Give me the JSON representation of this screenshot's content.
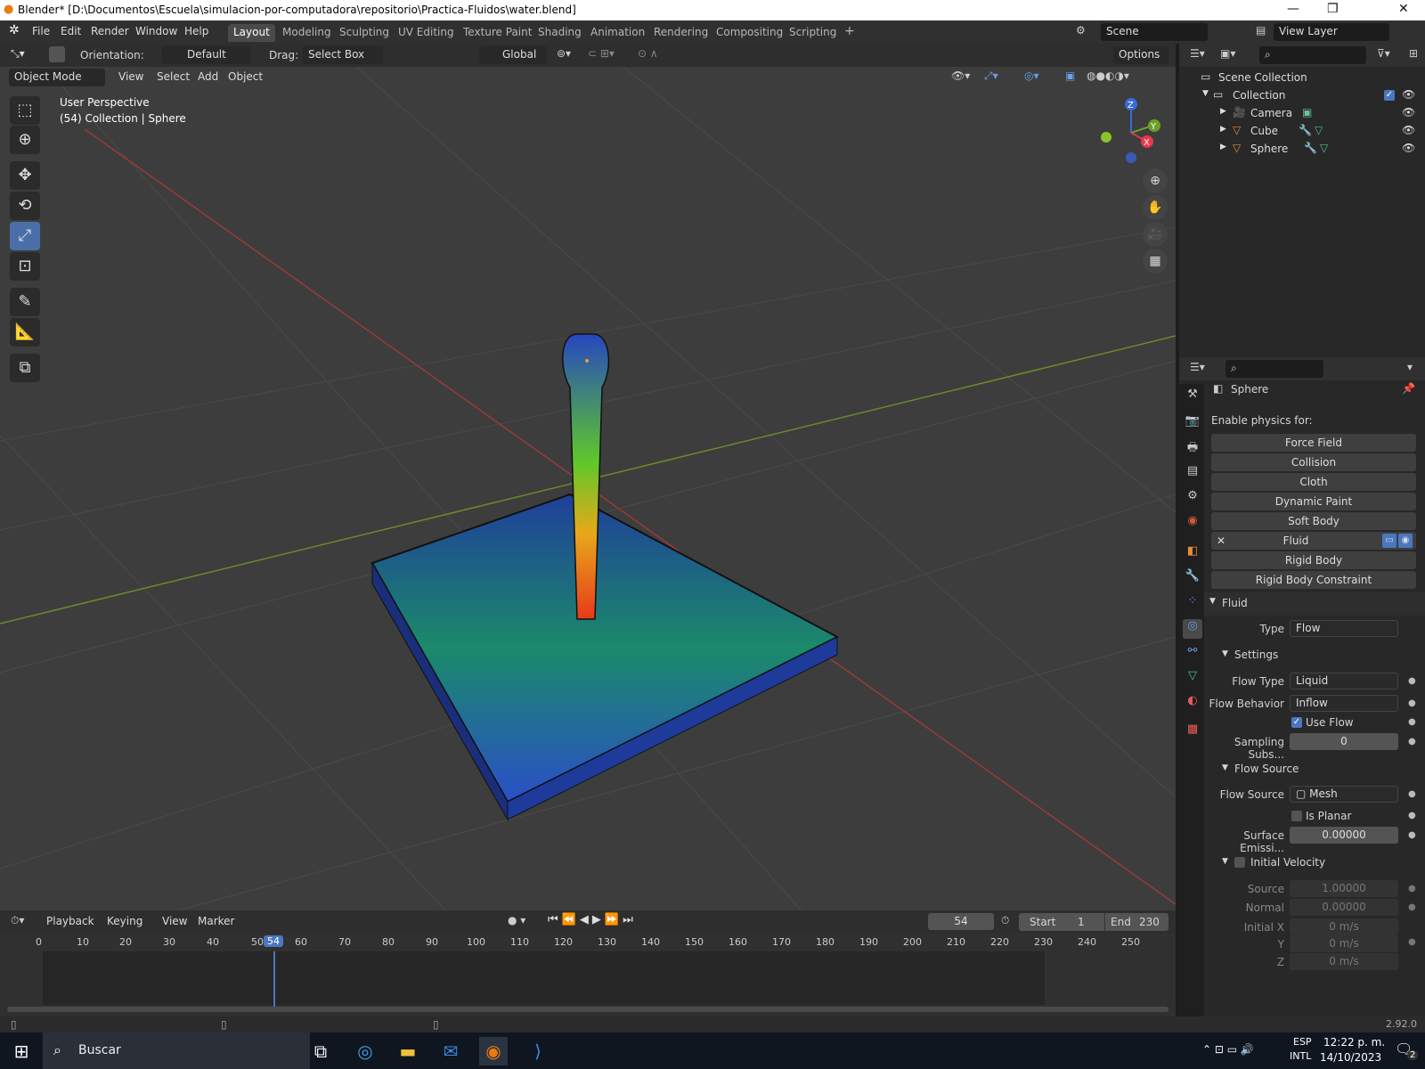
{
  "window": {
    "title": "Blender* [D:\\Documentos\\Escuela\\simulacion-por-computadora\\repositorio\\Practica-Fluidos\\water.blend]",
    "minimize": "—",
    "maximize": "❐",
    "close": "✕"
  },
  "menubar": {
    "items": [
      "File",
      "Edit",
      "Render",
      "Window",
      "Help"
    ],
    "workspaces": [
      "Layout",
      "Modeling",
      "Sculpting",
      "UV Editing",
      "Texture Paint",
      "Shading",
      "Animation",
      "Rendering",
      "Compositing",
      "Scripting"
    ],
    "add_tab": "+",
    "scene": "Scene",
    "view_layer": "View Layer"
  },
  "tool_header": {
    "orientation_label": "Orientation:",
    "orientation_value": "Default",
    "drag_label": "Drag:",
    "drag_value": "Select Box",
    "transform_orientation": "Global",
    "options": "Options"
  },
  "viewport_header": {
    "mode": "Object Mode",
    "menus": [
      "View",
      "Select",
      "Add",
      "Object"
    ]
  },
  "viewport": {
    "perspective": "User Perspective",
    "info": "(54) Collection | Sphere",
    "gizmo": {
      "z": "Z",
      "y": "Y",
      "x": "X"
    }
  },
  "outliner": {
    "scene_collection": "Scene Collection",
    "collection": "Collection",
    "objects": [
      "Camera",
      "Cube",
      "Sphere"
    ]
  },
  "properties": {
    "object_name": "Sphere",
    "enable_physics_label": "Enable physics for:",
    "physics_buttons": [
      "Force Field",
      "Collision",
      "Cloth",
      "Dynamic Paint",
      "Soft Body",
      "Fluid",
      "Rigid Body",
      "Rigid Body Constraint"
    ],
    "fluid_panel": "Fluid",
    "type_label": "Type",
    "type_value": "Flow",
    "settings_label": "Settings",
    "flow_type_label": "Flow Type",
    "flow_type_value": "Liquid",
    "flow_behavior_label": "Flow Behavior",
    "flow_behavior_value": "Inflow",
    "use_flow_label": "Use Flow",
    "sampling_label": "Sampling Subs...",
    "sampling_value": "0",
    "flow_source_section": "Flow Source",
    "flow_source_label": "Flow Source",
    "flow_source_value": "Mesh",
    "is_planar_label": "Is Planar",
    "surface_emission_label": "Surface Emissi...",
    "surface_emission_value": "0.00000",
    "initial_velocity_label": "Initial Velocity",
    "source_label": "Source",
    "source_value": "1.00000",
    "normal_label": "Normal",
    "normal_value": "0.00000",
    "initial_x_label": "Initial X",
    "initial_x_value": "0 m/s",
    "y_label": "Y",
    "y_value": "0 m/s",
    "z_label": "Z",
    "z_value": "0 m/s"
  },
  "timeline": {
    "menus": [
      "Playback",
      "Keying",
      "View",
      "Marker"
    ],
    "current_frame": "54",
    "start_label": "Start",
    "start_value": "1",
    "end_label": "End",
    "end_value": "230",
    "ticks": [
      "0",
      "10",
      "20",
      "30",
      "40",
      "50",
      "54",
      "60",
      "70",
      "80",
      "90",
      "100",
      "110",
      "120",
      "130",
      "140",
      "150",
      "160",
      "170",
      "180",
      "190",
      "200",
      "210",
      "220",
      "230",
      "240",
      "250"
    ]
  },
  "status": {
    "version": "2.92.0"
  },
  "taskbar": {
    "search": "Buscar",
    "lang1": "ESP",
    "lang2": "INTL",
    "time": "12:22 p. m.",
    "date": "14/10/2023",
    "notifications": "2"
  }
}
